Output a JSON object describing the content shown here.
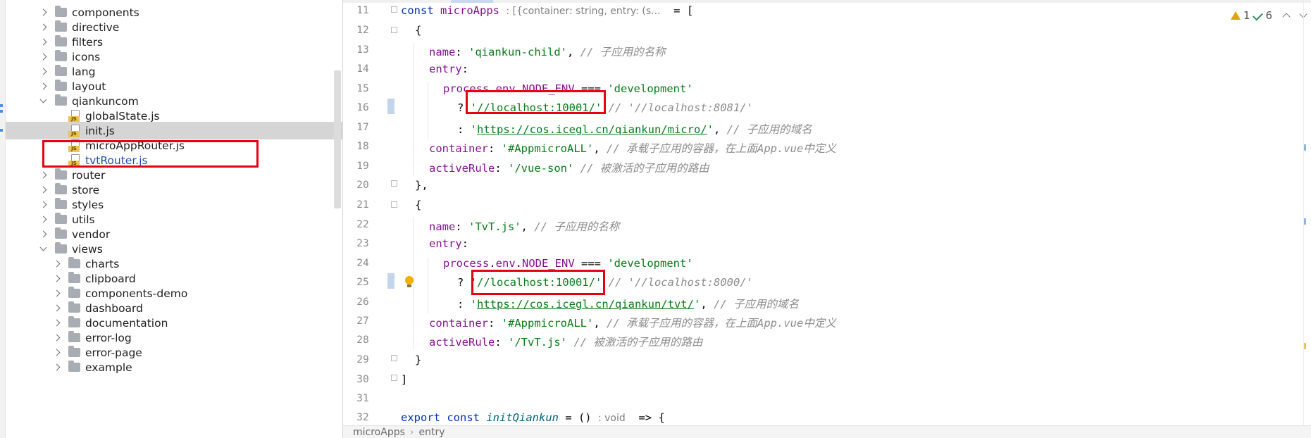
{
  "tree": {
    "items": [
      {
        "label": "components",
        "type": "folder",
        "depth": 1,
        "expanded": false
      },
      {
        "label": "directive",
        "type": "folder",
        "depth": 1,
        "expanded": false
      },
      {
        "label": "filters",
        "type": "folder",
        "depth": 1,
        "expanded": false
      },
      {
        "label": "icons",
        "type": "folder",
        "depth": 1,
        "expanded": false
      },
      {
        "label": "lang",
        "type": "folder",
        "depth": 1,
        "expanded": false
      },
      {
        "label": "layout",
        "type": "folder",
        "depth": 1,
        "expanded": false
      },
      {
        "label": "qiankuncom",
        "type": "folder",
        "depth": 1,
        "expanded": true
      },
      {
        "label": "globalState.js",
        "type": "js",
        "depth": 2
      },
      {
        "label": "init.js",
        "type": "js",
        "depth": 2,
        "selected": true
      },
      {
        "label": "microAppRouter.js",
        "type": "js",
        "depth": 2
      },
      {
        "label": "tvtRouter.js",
        "type": "js",
        "depth": 2
      },
      {
        "label": "router",
        "type": "folder",
        "depth": 1,
        "expanded": false
      },
      {
        "label": "store",
        "type": "folder",
        "depth": 1,
        "expanded": false
      },
      {
        "label": "styles",
        "type": "folder",
        "depth": 1,
        "expanded": false
      },
      {
        "label": "utils",
        "type": "folder",
        "depth": 1,
        "expanded": false
      },
      {
        "label": "vendor",
        "type": "folder",
        "depth": 1,
        "expanded": false
      },
      {
        "label": "views",
        "type": "folder",
        "depth": 1,
        "expanded": true
      },
      {
        "label": "charts",
        "type": "folder",
        "depth": 2,
        "expanded": false
      },
      {
        "label": "clipboard",
        "type": "folder",
        "depth": 2,
        "expanded": false
      },
      {
        "label": "components-demo",
        "type": "folder",
        "depth": 2,
        "expanded": false
      },
      {
        "label": "dashboard",
        "type": "folder",
        "depth": 2,
        "expanded": false
      },
      {
        "label": "documentation",
        "type": "folder",
        "depth": 2,
        "expanded": false
      },
      {
        "label": "error-log",
        "type": "folder",
        "depth": 2,
        "expanded": false
      },
      {
        "label": "error-page",
        "type": "folder",
        "depth": 2,
        "expanded": false
      },
      {
        "label": "example",
        "type": "folder",
        "depth": 2,
        "expanded": false
      }
    ],
    "js_badge": "JS"
  },
  "editor": {
    "line_numbers": [
      "11",
      "12",
      "13",
      "14",
      "15",
      "16",
      "17",
      "18",
      "19",
      "20",
      "21",
      "22",
      "23",
      "24",
      "25",
      "26",
      "27",
      "28",
      "29",
      "30",
      "31",
      "32"
    ],
    "code": {
      "l11": {
        "kw": "const",
        "name": "microApps",
        "hint": ": [{container: string, entry: (s...",
        "rest": "  = ["
      },
      "l12": "{",
      "l13": {
        "prop": "name",
        "sep": ": ",
        "str": "'qiankun-child'",
        "tail": ", ",
        "cmt": "// 子应用的名称"
      },
      "l14": {
        "prop": "entry",
        "sep": ":"
      },
      "l15": {
        "prop": "process",
        "dot1": ".",
        "prop2": "env",
        "dot2": ".",
        "prop3": "NODE_ENV",
        "op": " === ",
        "str": "'development'"
      },
      "l16": {
        "q": "? ",
        "str": "'//localhost:10001/'",
        "cmt": " // '//localhost:8081/'"
      },
      "l17": {
        "q": ": ",
        "q1": "'",
        "link": "https://cos.icegl.cn/qiankun/micro/",
        "q2": "'",
        "tail": ", ",
        "cmt": "// 子应用的域名"
      },
      "l18": {
        "prop": "container",
        "sep": ": ",
        "str": "'#AppmicroALL'",
        "tail": ", ",
        "cmt": "// 承载子应用的容器，在上面App.vue中定义"
      },
      "l19": {
        "prop": "activeRule",
        "sep": ": ",
        "str": "'/vue-son'",
        "tail": " ",
        "cmt": "// 被激活的子应用的路由"
      },
      "l20": "},",
      "l21": "{",
      "l22": {
        "prop": "name",
        "sep": ": ",
        "str": "'TvT.js'",
        "tail": ", ",
        "cmt": "// 子应用的名称"
      },
      "l23": {
        "prop": "entry",
        "sep": ":"
      },
      "l24": {
        "prop": "process",
        "dot1": ".",
        "prop2": "env",
        "dot2": ".",
        "prop3": "NODE_ENV",
        "op": " === ",
        "str": "'development'"
      },
      "l25": {
        "q": "? ",
        "str": "'//localhost:10001/'",
        "cmt": " // '//localhost:8000/'"
      },
      "l26": {
        "q": ": ",
        "q1": "'",
        "link": "https://cos.icegl.cn/qiankun/tvt/",
        "q2": "'",
        "tail": ", ",
        "cmt": "// 子应用的域名"
      },
      "l27": {
        "prop": "container",
        "sep": ": ",
        "str": "'#AppmicroALL'",
        "tail": ", ",
        "cmt": "// 承载子应用的容器，在上面App.vue中定义"
      },
      "l28": {
        "prop": "activeRule",
        "sep": ": ",
        "str": "'/TvT.js'",
        "tail": " ",
        "cmt": "// 被激活的子应用的路由"
      },
      "l29": "}",
      "l30": "]",
      "l31": "",
      "l32": {
        "kw1": "export",
        "kw2": " const ",
        "fn": "initQiankun",
        "op": " = () ",
        "hint": ": void",
        "rest": "  => {"
      }
    },
    "inspections": {
      "warnings": "1",
      "ok": "6"
    },
    "breadcrumb": [
      "microApps",
      "entry"
    ]
  },
  "colors": {
    "highlight_box": "#e60012",
    "selection": "#d5d5d5"
  }
}
